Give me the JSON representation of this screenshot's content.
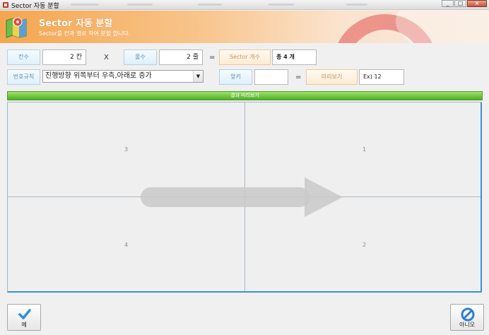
{
  "window": {
    "title": "Sector 자동 분할"
  },
  "header": {
    "title": "Sector 자동 분할",
    "subtitle": "Sector를 칸과 열로 하여 분할 합니다."
  },
  "form": {
    "cols_label": "칸수",
    "cols_value": "2 칸",
    "times_op": "X",
    "rows_label": "줄수",
    "rows_value": "2 줄",
    "equals_op": "=",
    "sector_count_label": "Sector 개수",
    "sector_count_value": "총 4 개",
    "numbering_label": "번호규칙",
    "numbering_value": "진행방향 위쪽부터 우측,아래로 증가",
    "prefix_label": "앞키",
    "prefix_value": "",
    "equals_op2": "=",
    "preview_label": "미리보기",
    "preview_value": "Ex) 12"
  },
  "preview": {
    "bar_label": "결과 미리보기",
    "cells": [
      "3",
      "1",
      "4",
      "2"
    ]
  },
  "footer": {
    "yes_label": "예",
    "no_label": "아니오"
  },
  "colors": {
    "accent_green": "#4fae23",
    "accent_blue": "#3d8fd6",
    "header_orange": "#f4a64f"
  },
  "icons": [
    "app-icon",
    "map-icon",
    "check-icon",
    "cancel-icon",
    "minimize-icon",
    "maximize-icon",
    "close-icon",
    "direction-arrow-icon",
    "dropdown-arrow-icon"
  ]
}
